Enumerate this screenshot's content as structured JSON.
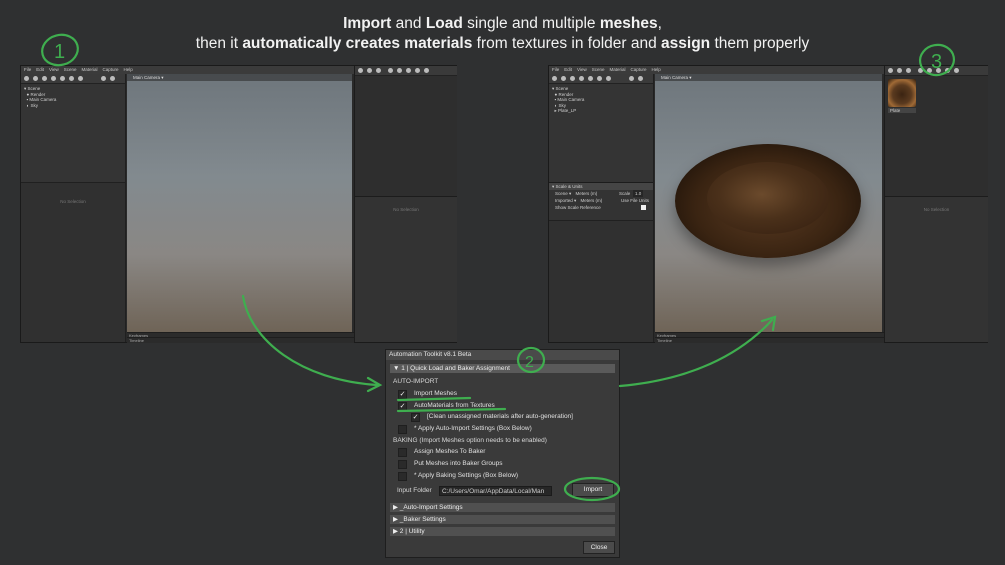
{
  "headline": {
    "line1": {
      "b1": "Import",
      "t1": " and ",
      "b2": "Load",
      "t2": " single and multiple ",
      "b3": "meshes",
      "t3": ","
    },
    "line2": {
      "t1": "then it ",
      "b1": "automatically creates materials",
      "t2": " from textures in folder and ",
      "b2": "assign",
      "t3": " them properly"
    }
  },
  "annotations": {
    "step1": "1",
    "step2": "2",
    "step3": "3"
  },
  "editor_left": {
    "menu": [
      "File",
      "Edit",
      "View",
      "Scene",
      "Material",
      "Capture",
      "Help"
    ],
    "tree": [
      "Scene",
      "Render",
      "Main Camera",
      "Sky"
    ],
    "viewport_label": "Main Camera ▾",
    "no_selection": "No Selection",
    "no_selection_right": "No Selection",
    "keyframes": "Keyframes",
    "timeline": "Timeline"
  },
  "editor_right": {
    "menu": [
      "File",
      "Edit",
      "View",
      "Scene",
      "Material",
      "Capture",
      "Help"
    ],
    "tree": [
      "Scene",
      "Render",
      "Main Camera",
      "Sky",
      "Plate_LP"
    ],
    "viewport_label": "Main Camera ▾",
    "material_name": "Plate",
    "no_selection": "No Selection",
    "scale_units": {
      "header": "▾ Scale & Units",
      "scene_label": "Scene ▾",
      "scene_units": "Meters (m)",
      "scale_label": "Scale",
      "scale_value": "1.0",
      "imported_label": "Imported ▾",
      "imported_units": "Meters (m)",
      "use_file_units": "Use File Units",
      "show_scale_reference": "Show Scale Reference"
    },
    "keyframes": "Keyframes",
    "timeline": "Timeline"
  },
  "dialog": {
    "title": "Automation Toolkit v8.1 Beta",
    "section1": "▼ 1 | Quick Load and Baker Assignment",
    "auto_import_heading": "AUTO-IMPORT",
    "options": [
      {
        "label": "Import Meshes",
        "checked": true
      },
      {
        "label": "AutoMaterials from Textures",
        "checked": true
      },
      {
        "label": "[Clean unassigned materials after auto-generation]",
        "checked": true
      },
      {
        "label": "* Apply Auto-Import Settings (Box Below)",
        "checked": false
      }
    ],
    "baking_heading": "BAKING (Import Meshes option needs to be enabled)",
    "baking_options": [
      {
        "label": "Assign Meshes To Baker",
        "checked": false
      },
      {
        "label": "Put Meshes into Baker Groups",
        "checked": false
      },
      {
        "label": "* Apply Baking Settings (Box Below)",
        "checked": false
      }
    ],
    "input_folder_label": "Input Folder",
    "input_folder_value": "C:/Users/Omar/AppData/Local/Man",
    "import_button": "Import",
    "collapsed_sections": [
      "▶ _Auto-Import Settings",
      "▶ _Baker Settings",
      "▶ 2 | Utility"
    ],
    "close_button": "Close"
  },
  "colors": {
    "annotation_green": "#3fae4f",
    "background": "#2f3031"
  }
}
